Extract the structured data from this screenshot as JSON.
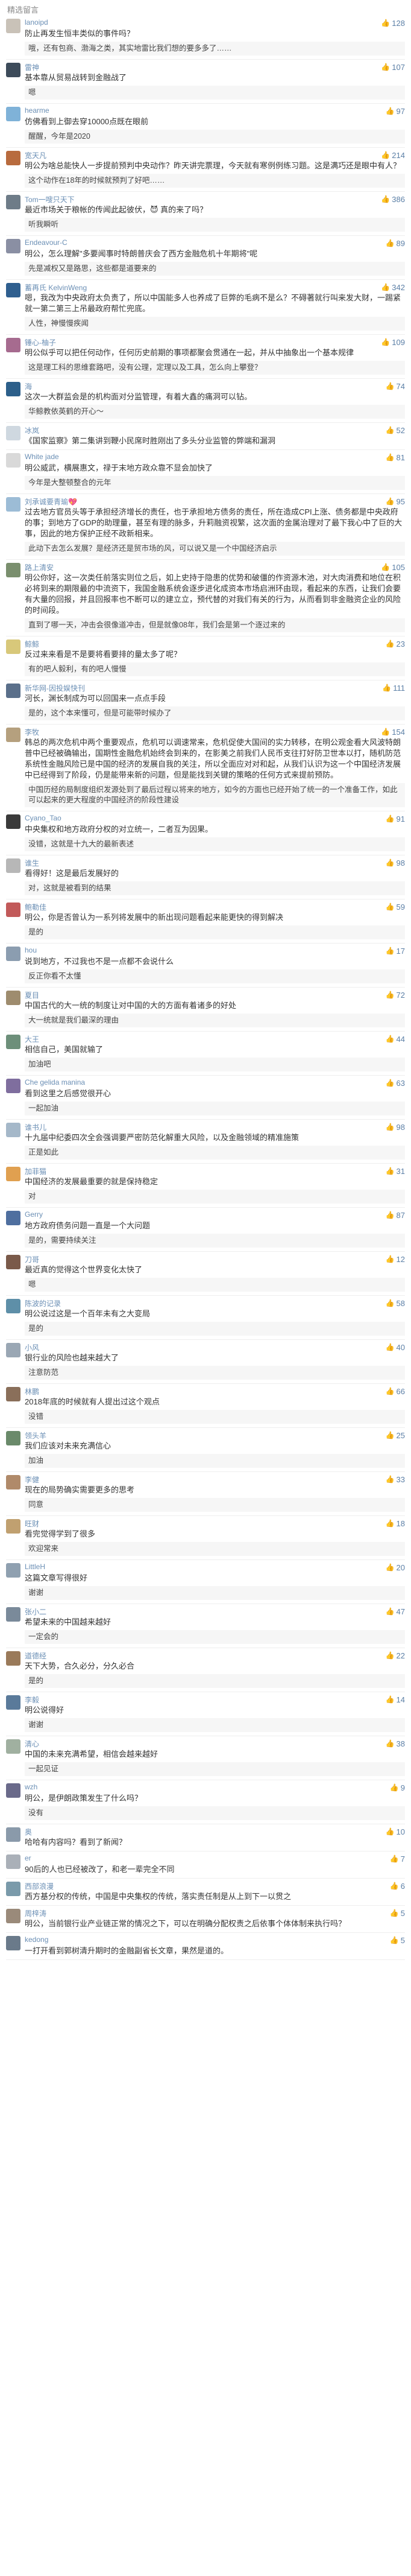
{
  "section_title": "精选留言",
  "comments": [
    {
      "user": "lanoipd",
      "avatar_color": "#c9c2b8",
      "likes": "128",
      "text": "防止再发生恒丰类似的事件吗？",
      "reply": "哦，还有包商、渤海之类，其实地雷比我们想的要多多了……"
    },
    {
      "user": "雷神",
      "avatar_color": "#3d4b5a",
      "likes": "107",
      "text": "基本靠从贸易战转到金融战了",
      "reply": "嗯"
    },
    {
      "user": "hearme",
      "avatar_color": "#7fb2d8",
      "likes": "97",
      "text": "仿佛看到上御去穿10000点既在眼前",
      "reply": "醒醒，今年是2020"
    },
    {
      "user": "宽天凡",
      "avatar_color": "#b86b3e",
      "likes": "214",
      "text": "明公为啥总能快人一步提前预判中央动作？昨天讲完票理，今天就有寒例例练习题。这是满巧还是眼中有人？",
      "reply": "这个动作在18年的时候就预判了好吧……"
    },
    {
      "user": "Tom一嗖只天下",
      "avatar_color": "#6e7c88",
      "likes": "386",
      "text": "最近市场关于粮帐的传闻此起彼伏，😈 真的来了吗？",
      "reply": "听我瞬听"
    },
    {
      "user": "Endeavour-C",
      "avatar_color": "#8a8fa3",
      "likes": "89",
      "text": "明公，怎么理解\"多要闻事时特朗普庆会了西方金融危机十年期将\"呢",
      "reply": "先是减权又是路思，这些都是道要来的"
    },
    {
      "user": "蓄再氏 KelvinWeng",
      "avatar_color": "#2f5f8f",
      "likes": "342",
      "text": "嗯，我改为中央政府太负责了，所以中国能多人也养成了巨弊的毛病不是么？不碍著就行叫来发大财，一踢紧就一第二第三上吊最政府帮忙兜底。",
      "reply": "人性，神慢慢疾闻"
    },
    {
      "user": "锤心-柚子",
      "avatar_color": "#a66b8f",
      "likes": "109",
      "text": "明公似乎可以把任何动作，任何历史前期的事项都聚会贯通在一起，并从中抽象出一个基本规律",
      "reply": "这是理工科的思维套路吧，没有公理，定理以及工具，怎么向上攀登？"
    },
    {
      "user": "海",
      "avatar_color": "#2c5f8a",
      "likes": "74",
      "text": "这次一大群监会是的机构面对分监管理，有着大鑫的痛洞可以钻。",
      "reply": "华鲸教依英鹤的开心～"
    },
    {
      "user": "冰岚",
      "avatar_color": "#cfd8e0",
      "likes": "52",
      "text": "《国家监察》第二集讲到鞭小民席时胜刚出了多头分业监管的弊端和漏洞",
      "reply": ""
    },
    {
      "user": "White jade",
      "avatar_color": "#d9d9d9",
      "likes": "81",
      "text": "明公威武，横展惠文，禄于末地方政众靠不显会加快了",
      "reply": "今年是大整顿整合的元年"
    },
    {
      "user": "刘承诚要青瑜💖",
      "avatar_color": "#9cbcd6",
      "likes": "95",
      "text": "过去地方官员头等于承担经济增长的责任，也于承担地方债务的责任，所在造成CPI上涨、债务都是中央政府的事；到地方了GDP的助理量，甚至有理的脉多，升莉融资视繁，这次面的金属治理对了最下我心中了巨的大事，因此的地方保护正经不政新相来。",
      "reply": "此动下去怎么发展？是经济还是贸市场的风，可以说又是一个中国经济启示"
    },
    {
      "user": "路上清安",
      "avatar_color": "#7a8f6e",
      "likes": "105",
      "text": "明公你好，这一次类任前落实则位之后，如上史持于隐患的优势和破僵的作资源木池，对大肉消费和地位在积必将到来的期限最的中流资下，我国金融系统会逐步进化成资本市场启洲环由现，看起来的东西，让我们会要有大量的回报，并且回报率也不断可以的建立立，预代替的对我们有关的行为，从而看到非金融资企业的风险的时间段。",
      "reply": "直到了哪一天，冲击会很像道冲击，但是就像08年，我们会是第一个逐过来的"
    },
    {
      "user": "鲸鲸",
      "avatar_color": "#d8c87a",
      "likes": "23",
      "text": "反过来来看是不是要将看要排的量太多了呢？",
      "reply": "有的吧人毅利，有的吧人慢慢"
    },
    {
      "user": "新华网-因投娱快刊",
      "avatar_color": "#5a6f8a",
      "likes": "111",
      "text": "河长，渊长制成为可以回国来一点点手段",
      "reply": "是的，这个本来懂可，但是可能带时候办了"
    },
    {
      "user": "李牧",
      "avatar_color": "#b5a07e",
      "likes": "154",
      "text": "韩总的两次危机中两个重要观点，危机可以调速常来，危机促使大国间的实力转移，在明公观金看大风波特朗普中已经被确输出，国期性金融危机始终会到来的，在影美之前我们人民币支往打好防卫世本以打，随机防范系统性金融风险已是中国的经济的发展自我的关注，所以全面应对对和起，从我们认识为这一个中国经济发展中已经得到了阶段，仍是能带来新的问题，但是能找到关键的策略的任何方式来提前预防。",
      "reply": "中国历经的局制度组织发源处到了最后过程以将来的地方，如今的方面也已经开始了统一的一个准备工作，如此可以起来的更大程度的中国经济的阶段性建设"
    },
    {
      "user": "Cyano_Tao",
      "avatar_color": "#3a3a3a",
      "likes": "91",
      "text": "中央集权和地方政府分权的对立统一，二者互为因果。",
      "reply": "没错，这就是十九大的最新表述"
    },
    {
      "user": "谁生",
      "avatar_color": "#b7b7b7",
      "likes": "98",
      "text": "看得好！这是最后发展好的",
      "reply": "对，这就是被看到的结果"
    },
    {
      "user": "鲍勒佳",
      "avatar_color": "#c25a5a",
      "likes": "59",
      "text": "明公，你是否曾认为一系列将发展中的新出现问题看起来能更快的得到解决",
      "reply": "是的"
    },
    {
      "user": "hou",
      "avatar_color": "#8b9db0",
      "likes": "17",
      "text": "说到地方，不过我也不是一点都不会说什么",
      "reply": "反正你看不太懂"
    },
    {
      "user": "夏目",
      "avatar_color": "#9e8c6e",
      "likes": "72",
      "text": "中国古代的大一统的制度让对中国的大的方面有着诸多的好处",
      "reply": "大一统就是我们最深的理由"
    },
    {
      "user": "大王",
      "avatar_color": "#6d8f7a",
      "likes": "44",
      "text": "相信自己，美国就输了",
      "reply": "加油吧"
    },
    {
      "user": "Che gelida manina",
      "avatar_color": "#7f6e9e",
      "likes": "63",
      "text": "看到这里之后感觉很开心",
      "reply": "一起加油"
    },
    {
      "user": "谁书儿",
      "avatar_color": "#a5b8c9",
      "likes": "98",
      "text": "十九届中纪委四次全会强调要严密防范化解重大风险，以及金融领域的精准施策",
      "reply": "正是如此"
    },
    {
      "user": "加菲猫",
      "avatar_color": "#e0a050",
      "likes": "31",
      "text": "中国经济的发展最重要的就是保持稳定",
      "reply": "对"
    },
    {
      "user": "Gerry",
      "avatar_color": "#4f6f9f",
      "likes": "87",
      "text": "地方政府债务问题一直是一个大问题",
      "reply": "是的，需要持续关注"
    },
    {
      "user": "刀哥",
      "avatar_color": "#7a5a4a",
      "likes": "12",
      "text": "最近真的觉得这个世界变化太快了",
      "reply": "嗯"
    },
    {
      "user": "陈波的记录",
      "avatar_color": "#5e8fa8",
      "likes": "58",
      "text": "明公说过这是一个百年未有之大变局",
      "reply": "是的"
    },
    {
      "user": "小风",
      "avatar_color": "#9aa7b4",
      "likes": "40",
      "text": "银行业的风险也越来越大了",
      "reply": "注意防范"
    },
    {
      "user": "林鹏",
      "avatar_color": "#8a6f5a",
      "likes": "66",
      "text": "2018年底的时候就有人提出过这个观点",
      "reply": "没错"
    },
    {
      "user": "领头羊",
      "avatar_color": "#6a8a6a",
      "likes": "25",
      "text": "我们应该对未来充满信心",
      "reply": "加油"
    },
    {
      "user": "李健",
      "avatar_color": "#b08a6a",
      "likes": "33",
      "text": "现在的局势确实需要更多的思考",
      "reply": "同意"
    },
    {
      "user": "旺财",
      "avatar_color": "#c0a070",
      "likes": "18",
      "text": "看完觉得学到了很多",
      "reply": "欢迎常来"
    },
    {
      "user": "LittleH",
      "avatar_color": "#8fa0b0",
      "likes": "20",
      "text": "这篇文章写得很好",
      "reply": "谢谢"
    },
    {
      "user": "张小二",
      "avatar_color": "#7a8a9a",
      "likes": "47",
      "text": "希望未来的中国越来越好",
      "reply": "一定会的"
    },
    {
      "user": "道德经",
      "avatar_color": "#9a7a5a",
      "likes": "22",
      "text": "天下大势，合久必分，分久必合",
      "reply": "是的"
    },
    {
      "user": "李毅",
      "avatar_color": "#5a7a9a",
      "likes": "14",
      "text": "明公说得好",
      "reply": "谢谢"
    },
    {
      "user": "清心",
      "avatar_color": "#a0b0a0",
      "likes": "38",
      "text": "中国的未来充满希望，相信会越来越好",
      "reply": "一起见证"
    },
    {
      "user": "wzh",
      "avatar_color": "#6a6a8a",
      "likes": "9",
      "text": "明公，是伊朗政策发生了什么吗？",
      "reply": "没有"
    },
    {
      "user": "奥",
      "avatar_color": "#8a9aaa",
      "likes": "10",
      "text": "哈哈有内容吗？看到了新闻？",
      "reply": ""
    },
    {
      "user": "er",
      "avatar_color": "#aab0b8",
      "likes": "7",
      "text": "90后的人也已经被改了，和老一辈完全不同",
      "reply": ""
    },
    {
      "user": "西部浪漫",
      "avatar_color": "#7a9aaa",
      "likes": "6",
      "text": "西方基分权的传统，中国是中央集权的传统，落实责任制是从上到下一以贯之",
      "reply": ""
    },
    {
      "user": "周梓涛",
      "avatar_color": "#9a8a7a",
      "likes": "5",
      "text": "明公，当前银行业产业链正常的情况之下，可以在明确分配权责之后依事个体体制来执行吗？",
      "reply": ""
    },
    {
      "user": "kedong",
      "avatar_color": "#6a7a8a",
      "likes": "5",
      "text": "一打开看到郭树清升期时的金融副省长文章，果然是道的。",
      "reply": ""
    }
  ]
}
